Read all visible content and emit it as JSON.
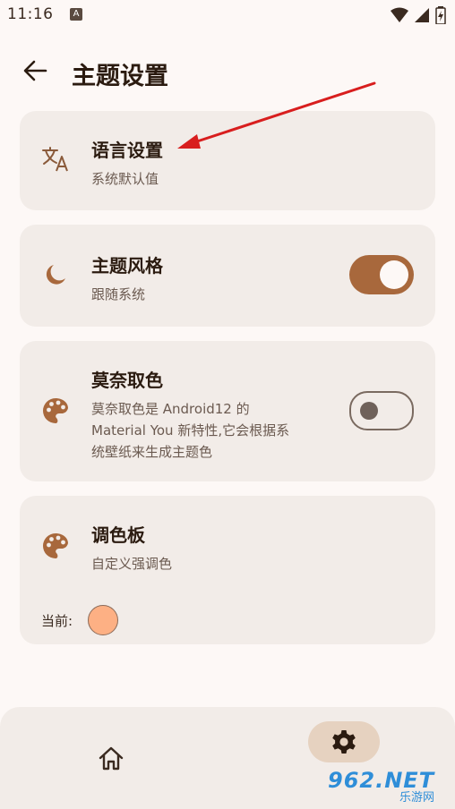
{
  "status": {
    "time": "11:16",
    "notif_icon": "A"
  },
  "header": {
    "title": "主题设置"
  },
  "cards": {
    "language": {
      "title": "语言设置",
      "subtitle": "系统默认值"
    },
    "theme_style": {
      "title": "主题风格",
      "subtitle": "跟随系统",
      "toggle_on": true
    },
    "monet": {
      "title": "莫奈取色",
      "subtitle_line1": "莫奈取色是 Android12 的",
      "subtitle_line2": "Material You 新特性,它会根据系",
      "subtitle_line3": "统壁纸来生成主题色",
      "toggle_on": false
    },
    "palette": {
      "title": "调色板",
      "subtitle": "自定义强调色",
      "current_label": "当前:",
      "current_color": "#fdb084"
    }
  },
  "watermark": {
    "main": "962.NET",
    "sub": "乐游网"
  },
  "colors": {
    "accent": "#a8683c",
    "card_bg": "#f2ece8",
    "page_bg": "#fdf8f6",
    "nav_pill": "#e6d2c0",
    "annotation_arrow": "#d81e1e"
  }
}
